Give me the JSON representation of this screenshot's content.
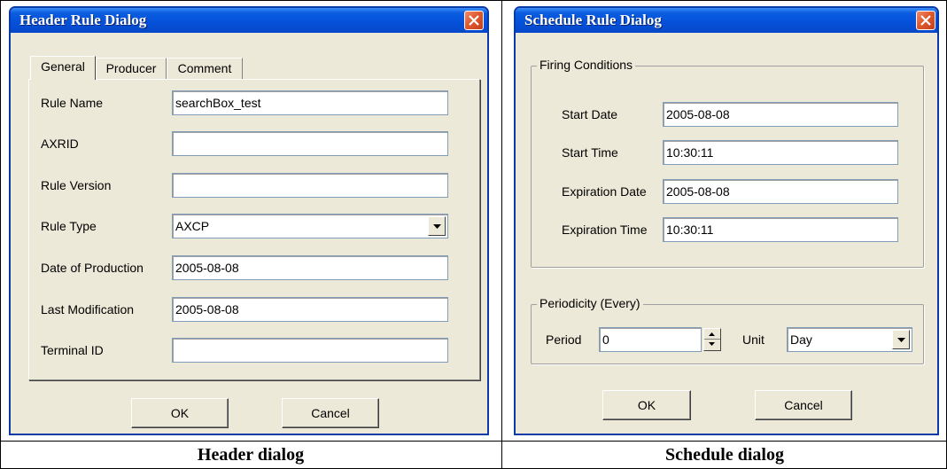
{
  "header_dialog": {
    "title": "Header Rule Dialog",
    "tabs": [
      {
        "label": "General",
        "active": true
      },
      {
        "label": "Producer",
        "active": false
      },
      {
        "label": "Comment",
        "active": false
      }
    ],
    "fields": [
      {
        "label": "Rule Name",
        "value": "searchBox_test"
      },
      {
        "label": "AXRID",
        "value": ""
      },
      {
        "label": "Rule Version",
        "value": ""
      },
      {
        "label": "Rule Type",
        "value": "AXCP"
      },
      {
        "label": "Date of Production",
        "value": "2005-08-08"
      },
      {
        "label": "Last Modification",
        "value": "2005-08-08"
      },
      {
        "label": "Terminal ID",
        "value": ""
      }
    ],
    "ok_label": "OK",
    "cancel_label": "Cancel"
  },
  "schedule_dialog": {
    "title": "Schedule Rule Dialog",
    "firing_group_title": "Firing Conditions",
    "firing_fields": [
      {
        "label": "Start Date",
        "value": "2005-08-08"
      },
      {
        "label": "Start Time",
        "value": "10:30:11"
      },
      {
        "label": "Expiration Date",
        "value": "2005-08-08"
      },
      {
        "label": "Expiration Time",
        "value": "10:30:11"
      }
    ],
    "periodicity_group_title": "Periodicity (Every)",
    "period_label": "Period",
    "period_value": "0",
    "unit_label": "Unit",
    "unit_value": "Day",
    "ok_label": "OK",
    "cancel_label": "Cancel"
  },
  "captions": {
    "left": "Header dialog",
    "right": "Schedule dialog"
  },
  "colors": {
    "titlebar": "#0550d9",
    "dialog_bg": "#ece9d8",
    "close_button": "#e05a2f"
  }
}
